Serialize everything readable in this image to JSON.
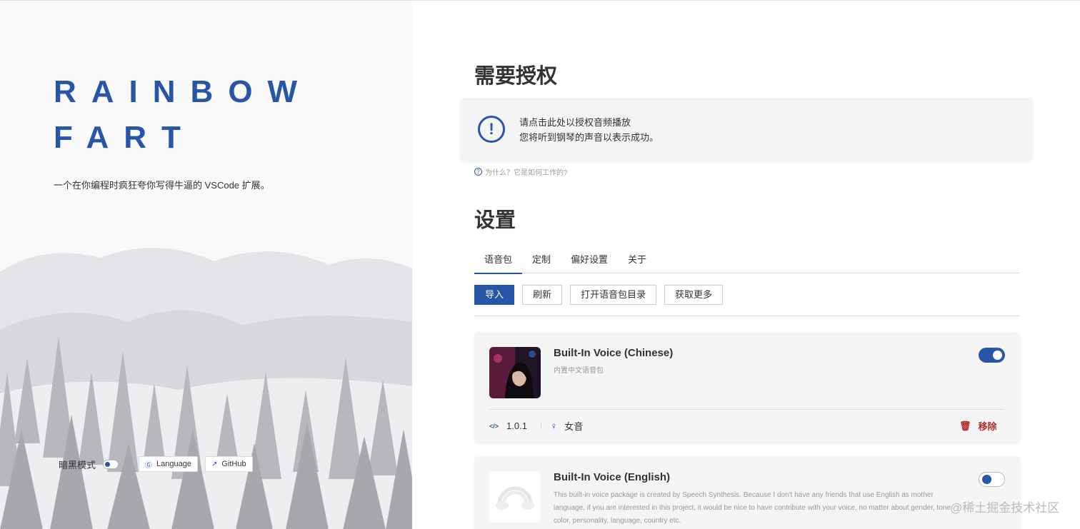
{
  "brand": {
    "line1": "RAINBOW",
    "line2": "FART",
    "tagline": "一个在你编程时疯狂夸你写得牛逼的 VSCode 扩展。"
  },
  "footer": {
    "dark_mode_label": "暗黑模式",
    "language_label": "Language",
    "github_label": "GitHub"
  },
  "auth": {
    "title": "需要授权",
    "line1": "请点击此处以授权音频播放",
    "line2": "您将听到钢琴的声音以表示成功。",
    "why_link": "为什么？它是如何工作的?"
  },
  "settings": {
    "title": "设置",
    "tabs": [
      {
        "label": "语音包",
        "active": true
      },
      {
        "label": "定制",
        "active": false
      },
      {
        "label": "偏好设置",
        "active": false
      },
      {
        "label": "关于",
        "active": false
      }
    ],
    "toolbar": {
      "import": "导入",
      "refresh": "刷新",
      "open_dir": "打开语音包目录",
      "get_more": "获取更多"
    }
  },
  "voices": [
    {
      "name": "Built-In Voice (Chinese)",
      "description": "内置中文语音包",
      "enabled": true,
      "version": "1.0.1",
      "gender": "女音",
      "remove_label": "移除"
    },
    {
      "name": "Built-In Voice (English)",
      "description": "This built-in voice package is created by Speech Synthesis. Because I don't have any friends that use English as mother language, if you are interested in this project, it would be nice to have contribute with your voice, no matter about gender, tone color, personality, language, country etc.",
      "enabled": false
    }
  ],
  "watermark": "@稀土掘金技术社区",
  "colors": {
    "accent": "#2756a8",
    "danger": "#b52b2b"
  }
}
